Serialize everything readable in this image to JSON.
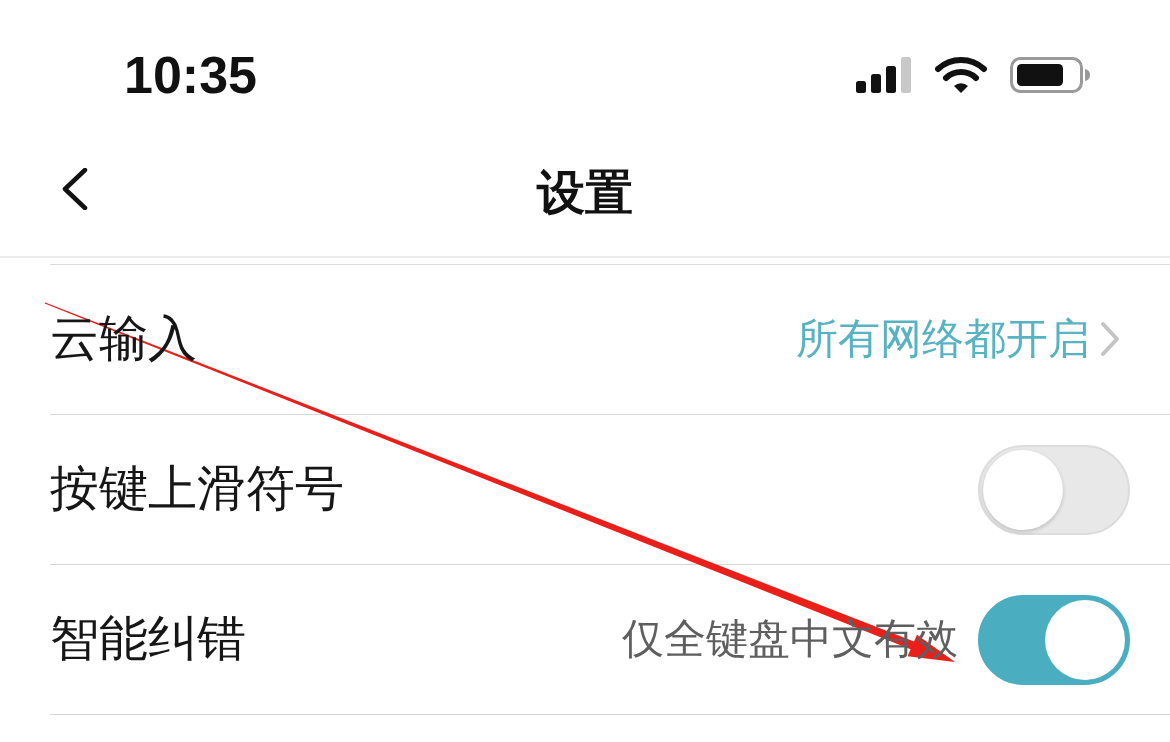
{
  "status_bar": {
    "time": "10:35"
  },
  "nav_bar": {
    "title": "设置"
  },
  "settings": [
    {
      "kind": "link",
      "label": "云输入",
      "value": "所有网络都开启"
    },
    {
      "kind": "toggle",
      "label": "按键上滑符号",
      "on": false
    },
    {
      "kind": "toggle",
      "label": "智能纠错",
      "hint": "仅全键盘中文有效",
      "on": true
    }
  ],
  "annotation": {
    "kind": "arrow"
  }
}
